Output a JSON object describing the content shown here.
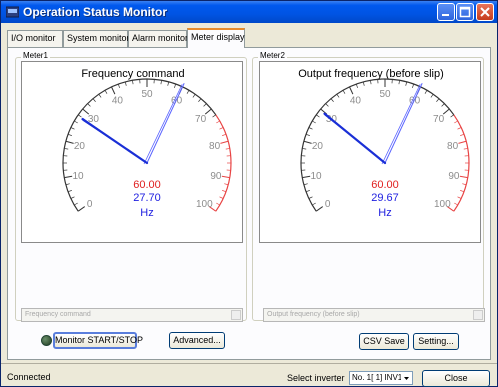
{
  "window": {
    "title": "Operation Status Monitor"
  },
  "tabs": [
    {
      "label": "I/O monitor"
    },
    {
      "label": "System monitor"
    },
    {
      "label": "Alarm monitor"
    },
    {
      "label": "Meter display"
    }
  ],
  "meters": [
    {
      "group_label": "Meter1",
      "title": "Frequency command",
      "value_red": "60.00",
      "value_blue": "27.70",
      "unit": "Hz",
      "scale": [
        "0",
        "10",
        "20",
        "30",
        "40",
        "50",
        "60",
        "70",
        "80",
        "90",
        "100"
      ],
      "needle_value": 27.7,
      "marker_value": 60.0,
      "combo_value": "Frequency command"
    },
    {
      "group_label": "Meter2",
      "title": "Output frequency (before slip)",
      "value_red": "60.00",
      "value_blue": "29.67",
      "unit": "Hz",
      "scale": [
        "0",
        "10",
        "20",
        "30",
        "40",
        "50",
        "60",
        "70",
        "80",
        "90",
        "100"
      ],
      "needle_value": 29.67,
      "marker_value": 60.0,
      "combo_value": "Output frequency (before slip)"
    }
  ],
  "buttons": {
    "monitor": "Monitor START/STOP",
    "advanced": "Advanced...",
    "csv_save": "CSV Save",
    "setting": "Setting...",
    "close": "Close"
  },
  "status": {
    "connection": "Connected",
    "select_label": "Select inverter",
    "select_value": "No. 1[ 1] INV1"
  },
  "colors": {
    "needle_blue": "#1a2fd6",
    "marker_blue": "#5a64ff",
    "scale_red": "#e84444",
    "value_red": "#e02020",
    "value_blue": "#2020e0"
  }
}
